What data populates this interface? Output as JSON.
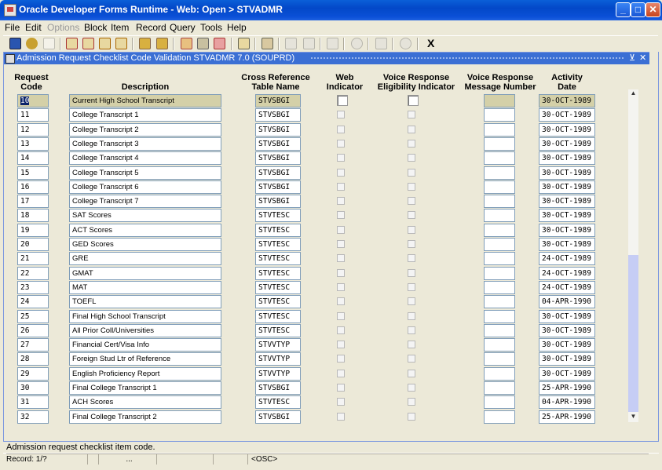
{
  "window": {
    "title": "Oracle Developer Forms Runtime - Web:  Open > STVADMR"
  },
  "menu": [
    "File",
    "Edit",
    "Options",
    "Block",
    "Item",
    "Record",
    "Query",
    "Tools",
    "Help"
  ],
  "toolbar": {
    "exit_label": "X"
  },
  "form": {
    "title": "Admission Request Checklist Code Validation  STVADMR  7.0  (SOUPRD)",
    "columns": {
      "code": "Request\nCode",
      "description": "Description",
      "crossref": "Cross Reference\nTable Name",
      "web": "Web\nIndicator",
      "voice_elig": "Voice Response\nEligibility Indicator",
      "voice_msg": "Voice Response\nMessage Number",
      "activity": "Activity\nDate"
    },
    "rows": [
      {
        "code": "10",
        "desc": "Current High School Transcript",
        "table": "STVSBGI",
        "date": "30-OCT-1989"
      },
      {
        "code": "11",
        "desc": "College Transcript 1",
        "table": "STVSBGI",
        "date": "30-OCT-1989"
      },
      {
        "code": "12",
        "desc": "College Transcript 2",
        "table": "STVSBGI",
        "date": "30-OCT-1989"
      },
      {
        "code": "13",
        "desc": "College Transcript 3",
        "table": "STVSBGI",
        "date": "30-OCT-1989"
      },
      {
        "code": "14",
        "desc": "College Transcript 4",
        "table": "STVSBGI",
        "date": "30-OCT-1989"
      },
      {
        "code": "15",
        "desc": "College Transcript 5",
        "table": "STVSBGI",
        "date": "30-OCT-1989"
      },
      {
        "code": "16",
        "desc": "College Transcript 6",
        "table": "STVSBGI",
        "date": "30-OCT-1989"
      },
      {
        "code": "17",
        "desc": "College Transcript 7",
        "table": "STVSBGI",
        "date": "30-OCT-1989"
      },
      {
        "code": "18",
        "desc": "SAT Scores",
        "table": "STVTESC",
        "date": "30-OCT-1989"
      },
      {
        "code": "19",
        "desc": "ACT Scores",
        "table": "STVTESC",
        "date": "30-OCT-1989"
      },
      {
        "code": "20",
        "desc": "GED Scores",
        "table": "STVTESC",
        "date": "30-OCT-1989"
      },
      {
        "code": "21",
        "desc": "GRE",
        "table": "STVTESC",
        "date": "24-OCT-1989"
      },
      {
        "code": "22",
        "desc": "GMAT",
        "table": "STVTESC",
        "date": "24-OCT-1989"
      },
      {
        "code": "23",
        "desc": "MAT",
        "table": "STVTESC",
        "date": "24-OCT-1989"
      },
      {
        "code": "24",
        "desc": "TOEFL",
        "table": "STVTESC",
        "date": "04-APR-1990"
      },
      {
        "code": "25",
        "desc": "Final High School Transcript",
        "table": "STVTESC",
        "date": "30-OCT-1989"
      },
      {
        "code": "26",
        "desc": "All Prior Coll/Universities",
        "table": "STVTESC",
        "date": "30-OCT-1989"
      },
      {
        "code": "27",
        "desc": "Financial Cert/Visa Info",
        "table": "STVVTYP",
        "date": "30-OCT-1989"
      },
      {
        "code": "28",
        "desc": "Foreign Stud Ltr of Reference",
        "table": "STVVTYP",
        "date": "30-OCT-1989"
      },
      {
        "code": "29",
        "desc": "English Proficiency Report",
        "table": "STVVTYP",
        "date": "30-OCT-1989"
      },
      {
        "code": "30",
        "desc": "Final College Transcript 1",
        "table": "STVSBGI",
        "date": "25-APR-1990"
      },
      {
        "code": "31",
        "desc": "ACH Scores",
        "table": "STVTESC",
        "date": "04-APR-1990"
      },
      {
        "code": "32",
        "desc": "Final College Transcript 2",
        "table": "STVSBGI",
        "date": "25-APR-1990"
      }
    ]
  },
  "hint": "Admission request checklist item code.",
  "status": {
    "record": "Record: 1/?",
    "dots": "...",
    "osc": "<OSC>"
  }
}
